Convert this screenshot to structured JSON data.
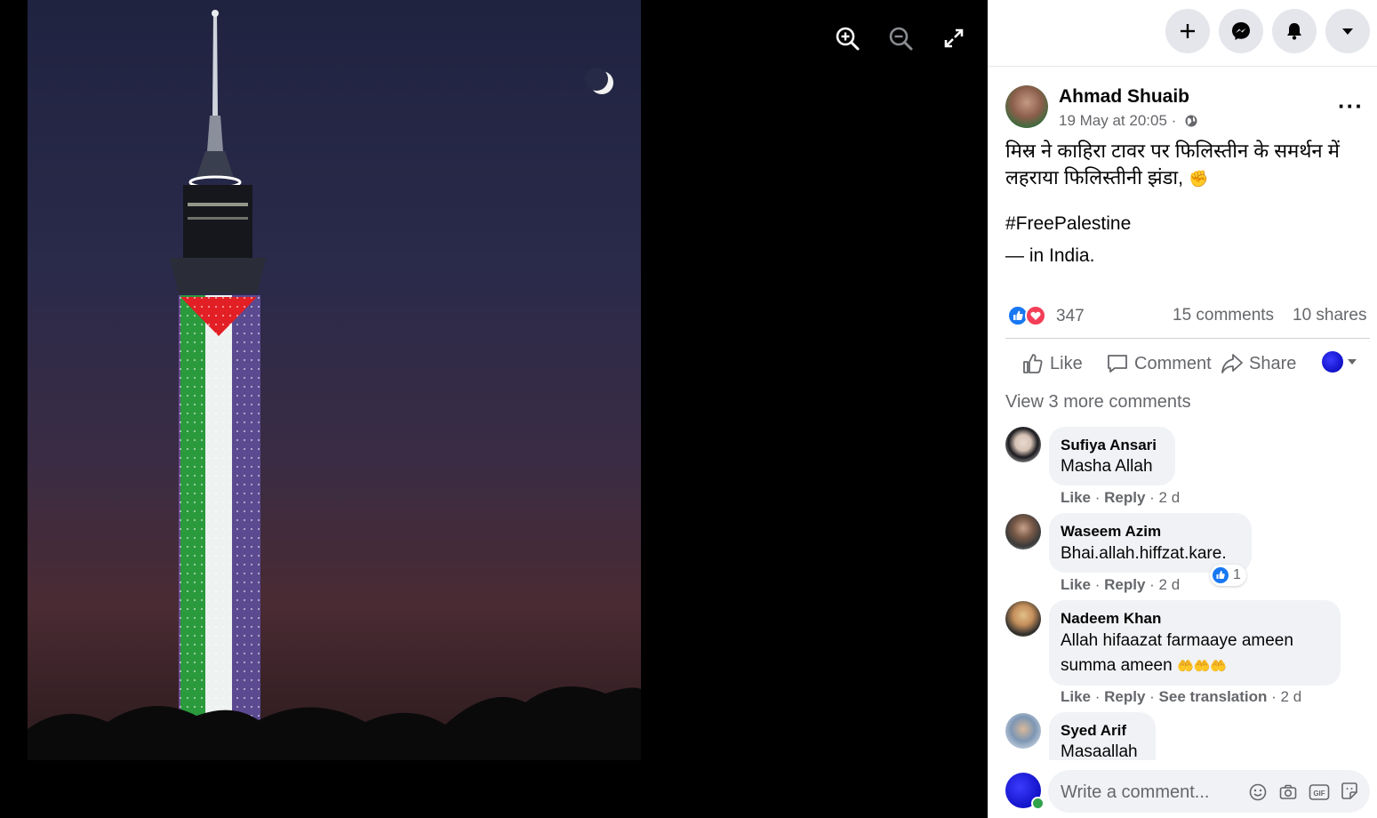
{
  "viewer": {
    "zoom_in_icon": "zoom-in-icon",
    "zoom_out_icon": "zoom-out-icon",
    "fullscreen_icon": "fullscreen-icon"
  },
  "topbar": {
    "buttons": [
      "plus-icon",
      "messenger-icon",
      "bell-icon",
      "caret-down-icon"
    ]
  },
  "post": {
    "author": "Ahmad Shuaib",
    "timestamp": "19 May at 20:05 ·",
    "text_line1": "मिस्र ने काहिरा टावर पर फिलिस्तीन के समर्थन में",
    "text_line2": "लहराया फिलिस्तीनी झंडा,",
    "emoji": "✊",
    "hashtag": "#FreePalestine",
    "location_prefix": "— in",
    "location": "India",
    "location_suffix": ".",
    "reactions_count": "347",
    "comments_count": "15 comments",
    "shares_count": "10 shares"
  },
  "actions": {
    "like": "Like",
    "comment": "Comment",
    "share": "Share"
  },
  "comments_section": {
    "view_more": "View 3 more comments",
    "comments": [
      {
        "name": "Sufiya Ansari",
        "text": "Masha Allah",
        "like": "Like",
        "reply": "Reply",
        "time": "· 2 d"
      },
      {
        "name": "Waseem Azim",
        "text": "Bhai.allah.hiffzat.kare.",
        "like": "Like",
        "reply": "Reply",
        "time": "· 2 d",
        "reaction_count": "1"
      },
      {
        "name": "Nadeem Khan",
        "text_line1": "Allah hifaazat farmaaye ameen",
        "text_line2": "summa ameen",
        "emoji": "🤲🤲🤲",
        "like": "Like",
        "reply": "Reply",
        "translate": "See translation",
        "time": "· 2 d"
      },
      {
        "name": "Syed Arif",
        "text": "Masaallah"
      }
    ],
    "write_placeholder": "Write a comment..."
  },
  "colors": {
    "accent": "#1877f2",
    "muted": "#65676b",
    "bubble": "#f0f2f5"
  }
}
